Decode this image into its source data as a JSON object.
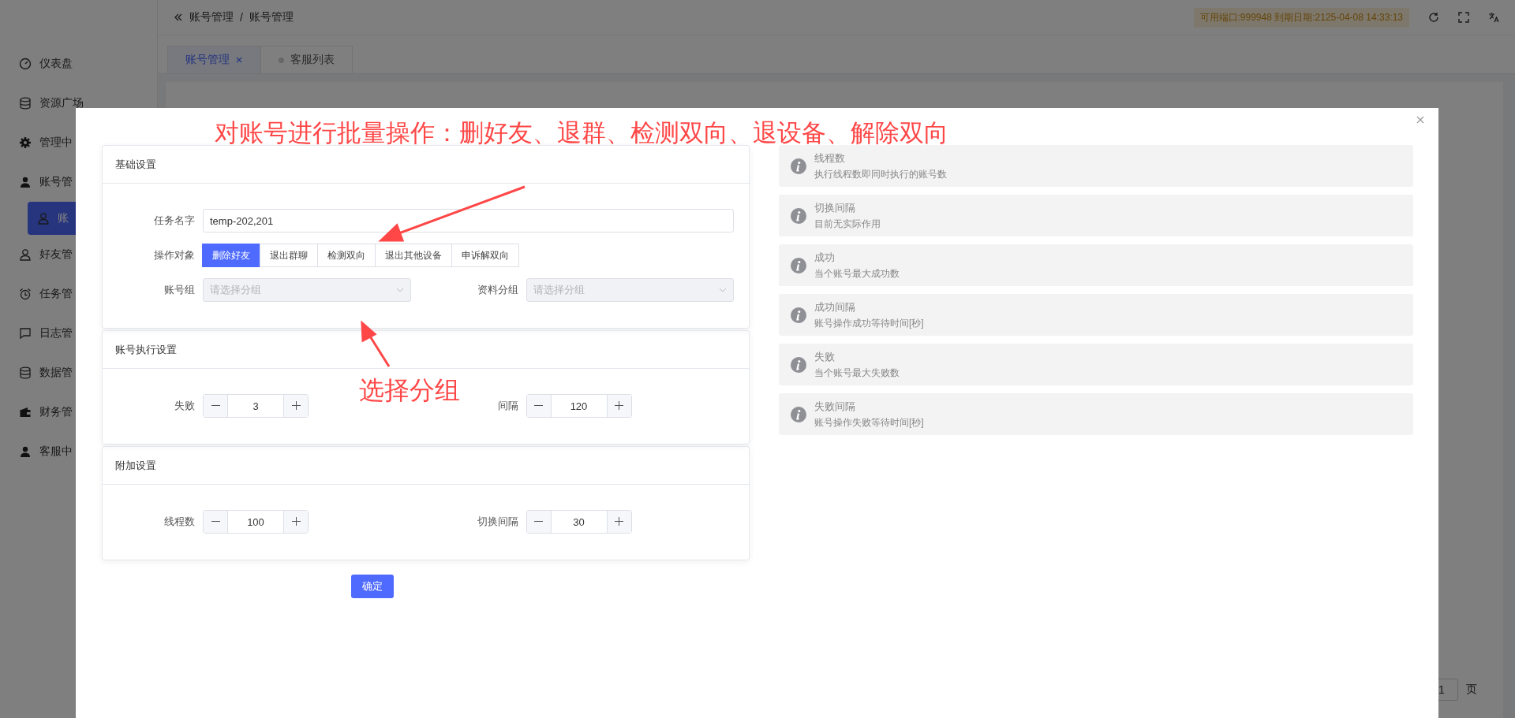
{
  "header": {
    "breadcrumb": [
      "账号管理",
      "账号管理"
    ],
    "separator": "/",
    "license": "可用端口:999948 到期日期:2125-04-08 14:33:13"
  },
  "tabs": [
    {
      "label": "账号管理",
      "selected": true,
      "closable": true
    },
    {
      "label": "客服列表",
      "selected": false,
      "closable": false
    }
  ],
  "sidebar": {
    "items": [
      {
        "label": "仪表盘",
        "selected": false
      },
      {
        "label": "资源广场",
        "selected": false
      },
      {
        "label": "管理中",
        "selected": false
      },
      {
        "label": "账号管",
        "selected": false,
        "children": [
          {
            "label": "账",
            "selected": true
          }
        ]
      },
      {
        "label": "好友管",
        "selected": false
      },
      {
        "label": "任务管",
        "selected": false
      },
      {
        "label": "日志管",
        "selected": false
      },
      {
        "label": "数据管",
        "selected": false
      },
      {
        "label": "财务管",
        "selected": false
      },
      {
        "label": "客服中",
        "selected": false
      }
    ]
  },
  "pagination": {
    "page": "1",
    "unit": "页"
  },
  "dialog": {
    "sections": [
      {
        "title": "基础设置",
        "fields": [
          {
            "kind": "text",
            "label": "任务名字",
            "value": "temp-202,201"
          },
          {
            "kind": "segmented",
            "label": "操作对象",
            "options": [
              {
                "label": "删除好友",
                "selected": true
              },
              {
                "label": "退出群聊",
                "selected": false
              },
              {
                "label": "检测双向",
                "selected": false
              },
              {
                "label": "退出其他设备",
                "selected": false
              },
              {
                "label": "申诉解双向",
                "selected": false
              }
            ]
          },
          {
            "kind": "select",
            "label": "账号组",
            "placeholder": "请选择分组",
            "disabled": true
          },
          {
            "kind": "select",
            "label": "资料分组",
            "placeholder": "请选择分组",
            "disabled": true
          }
        ]
      },
      {
        "title": "账号执行设置",
        "fields": [
          {
            "kind": "stepper",
            "label": "失败",
            "value": "3"
          },
          {
            "kind": "stepper",
            "label": "间隔",
            "value": "120"
          }
        ]
      },
      {
        "title": "附加设置",
        "fields": [
          {
            "kind": "stepper",
            "label": "线程数",
            "value": "100"
          },
          {
            "kind": "stepper",
            "label": "切换间隔",
            "value": "30"
          }
        ]
      }
    ],
    "confirm": "确定",
    "info": [
      {
        "title": "线程数",
        "description": "执行线程数即同时执行的账号数"
      },
      {
        "title": "切换间隔",
        "description": "目前无实际作用"
      },
      {
        "title": "成功",
        "description": "当个账号最大成功数"
      },
      {
        "title": "成功间隔",
        "description": "账号操作成功等待时间[秒]"
      },
      {
        "title": "失败",
        "description": "当个账号最大失败数"
      },
      {
        "title": "失败间隔",
        "description": "账号操作失败等待时间[秒]"
      }
    ]
  },
  "annotations": [
    {
      "kind": "headline",
      "text": "对账号进行批量操作：删好友、退群、检测双向、退设备、解除双向"
    },
    {
      "kind": "label",
      "text": "选择分组"
    }
  ]
}
